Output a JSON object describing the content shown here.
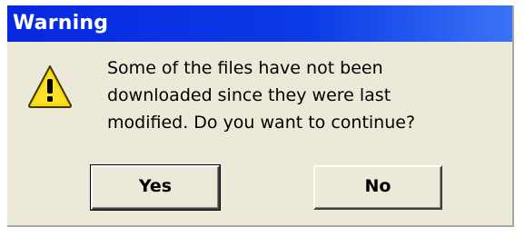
{
  "dialog": {
    "title": "Warning",
    "message_lines": [
      "Some of the files have not been",
      "downloaded since they were last",
      "modified. Do you want to continue?"
    ],
    "icon": "warning-triangle-icon",
    "buttons": {
      "yes": "Yes",
      "no": "No"
    }
  },
  "colors": {
    "titlebar": "#0b3be6",
    "dialog_background": "#ece9d8",
    "icon_fill": "#ffd700"
  }
}
